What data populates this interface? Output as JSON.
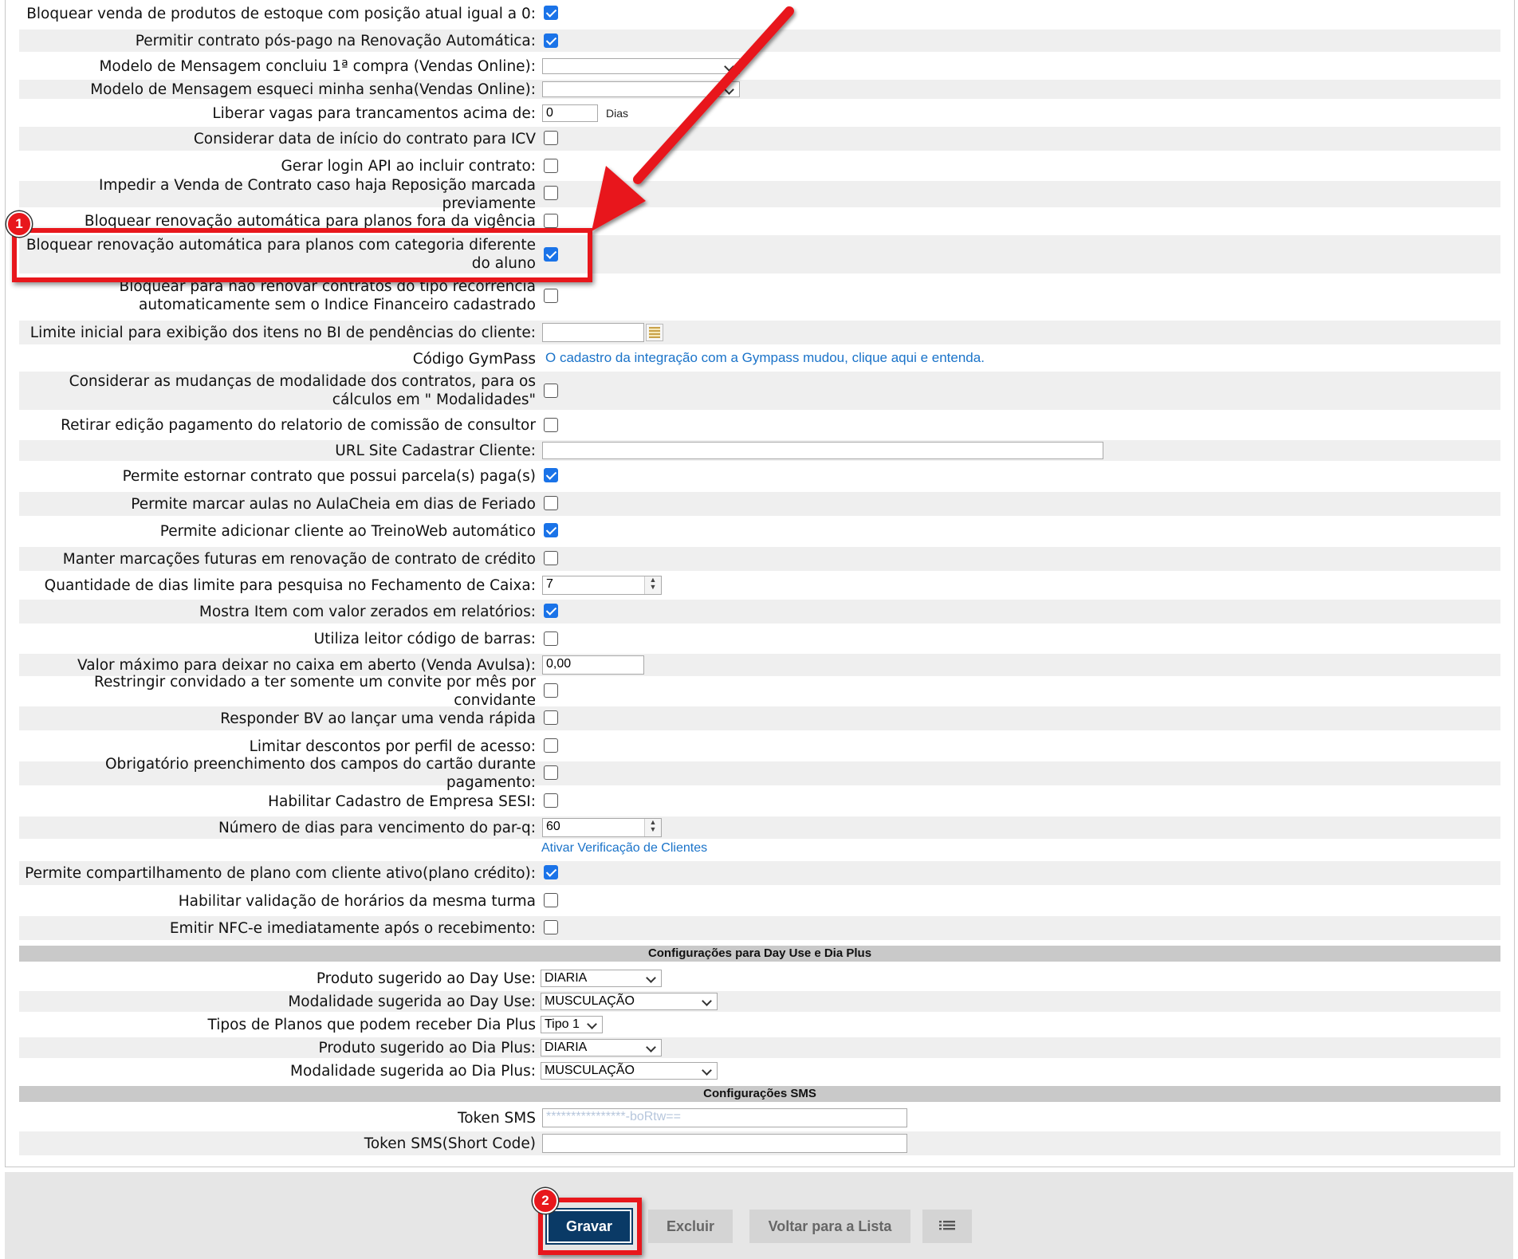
{
  "rows": [
    {
      "label": "Bloquear venda de produtos de estoque com posição atual igual a 0:",
      "checked": true
    },
    {
      "label": "Permitir contrato pós-pago na Renovação Automática:",
      "checked": true
    },
    {
      "label": "Modelo de Mensagem concluiu 1ª compra (Vendas Online):"
    },
    {
      "label": "Modelo de Mensagem esqueci minha senha(Vendas Online):"
    },
    {
      "label": "Liberar vagas para trancamentos acima de:",
      "value": "0",
      "unit": "Dias"
    },
    {
      "label": "Considerar data de início do contrato para ICV",
      "checked": false
    },
    {
      "label": "Gerar login API ao incluir contrato:",
      "checked": false
    },
    {
      "label": "Impedir a Venda de Contrato caso haja Reposição marcada previamente",
      "checked": false
    },
    {
      "label": "Bloquear renovação automática para planos fora da vigência",
      "checked": false
    },
    {
      "label": "Bloquear renovação automática para planos com categoria diferente do aluno",
      "checked": true
    },
    {
      "label": "Bloquear para não renovar contratos do tipo recorrência automaticamente sem o Indice Financeiro cadastrado",
      "checked": false
    },
    {
      "label": "Limite inicial para exibição dos itens no BI de pendências do cliente:"
    },
    {
      "label": "Código GymPass",
      "link": "O cadastro da integração com a Gympass mudou, clique aqui e entenda."
    },
    {
      "label": "Considerar as mudanças de modalidade dos contratos, para os cálculos em \" Modalidades\"",
      "checked": false
    },
    {
      "label": "Retirar edição pagamento do relatorio de comissão de consultor",
      "checked": false
    },
    {
      "label": "URL Site Cadastrar Cliente:"
    },
    {
      "label": "Permite estornar contrato que possui parcela(s) paga(s)",
      "checked": true
    },
    {
      "label": "Permite marcar aulas no AulaCheia em dias de Feriado",
      "checked": false
    },
    {
      "label": "Permite adicionar cliente ao TreinoWeb automático",
      "checked": true
    },
    {
      "label": "Manter marcações futuras em renovação de contrato de crédito",
      "checked": false
    },
    {
      "label": "Quantidade de dias limite para pesquisa no Fechamento de Caixa:",
      "value": "7"
    },
    {
      "label": "Mostra Item com valor zerados em relatórios:",
      "checked": true
    },
    {
      "label": "Utiliza leitor código de barras:",
      "checked": false
    },
    {
      "label": "Valor máximo para deixar no caixa em aberto (Venda Avulsa):",
      "value": "0,00"
    },
    {
      "label": "Restringir convidado a ter somente um convite por mês por convidante",
      "checked": false
    },
    {
      "label": "Responder BV ao lançar uma venda rápida",
      "checked": false
    },
    {
      "label": "Limitar descontos por perfil de acesso:",
      "checked": false
    },
    {
      "label": "Obrigatório preenchimento dos campos do cartão durante pagamento:",
      "checked": false
    },
    {
      "label": "Habilitar Cadastro de Empresa SESI:",
      "checked": false
    },
    {
      "label": "Número de dias para vencimento do par-q:",
      "value": "60",
      "link": "Ativar Verificação de Clientes"
    },
    {
      "label": "Permite compartilhamento de plano com cliente ativo(plano crédito):",
      "checked": true
    },
    {
      "label": "Habilitar validação de horários da mesma turma",
      "checked": false
    },
    {
      "label": "Emitir NFC-e imediatamente após o recebimento:",
      "checked": false
    }
  ],
  "dayuse": {
    "title": "Configurações para Day Use e Dia Plus",
    "rows": [
      {
        "label": "Produto sugerido ao Day Use:",
        "value": "DIARIA"
      },
      {
        "label": "Modalidade sugerida ao Day Use:",
        "value": "MUSCULAÇÃO"
      },
      {
        "label": "Tipos de Planos que podem receber Dia Plus",
        "value": "Tipo 1"
      },
      {
        "label": "Produto sugerido ao Dia Plus:",
        "value": "DIARIA"
      },
      {
        "label": "Modalidade sugerida ao Dia Plus:",
        "value": "MUSCULAÇÃO"
      }
    ]
  },
  "sms": {
    "title": "Configurações SMS",
    "rows": [
      {
        "label": "Token SMS",
        "value": "****************-boRtw=="
      },
      {
        "label": "Token SMS(Short Code)",
        "value": ""
      }
    ]
  },
  "footer": {
    "save": "Gravar",
    "delete": "Excluir",
    "back": "Voltar para a Lista",
    "list_icon": "list-icon"
  },
  "annotations": {
    "badge1": "1",
    "badge2": "2"
  },
  "colors": {
    "accent": "#1a73e8",
    "highlight": "#e8171c",
    "primary_button": "#0a3a66"
  }
}
